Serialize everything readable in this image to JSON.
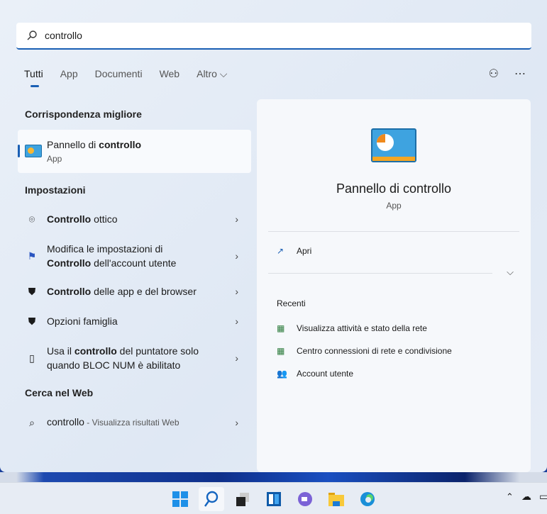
{
  "search": {
    "value": "controllo"
  },
  "tabs": [
    {
      "label": "Tutti"
    },
    {
      "label": "App"
    },
    {
      "label": "Documenti"
    },
    {
      "label": "Web"
    },
    {
      "label": "Altro ⌵"
    }
  ],
  "best_match": {
    "heading": "Corrispondenza migliore",
    "title_normal": "Pannello di ",
    "title_bold": "controllo",
    "subtitle": "App"
  },
  "settings": {
    "heading": "Impostazioni",
    "items": [
      {
        "bold": "Controllo",
        "rest": " ottico",
        "icon": "eye-scan-icon"
      },
      {
        "pre": "Modifica le impostazioni di",
        "bold": "Controllo",
        "rest": " dell'account utente",
        "icon": "flag-icon"
      },
      {
        "bold": "Controllo",
        "rest": " delle app e del browser",
        "icon": "shield-icon"
      },
      {
        "bold": "",
        "rest": "Opzioni famiglia",
        "icon": "shield-icon"
      },
      {
        "pre1": "Usa il ",
        "bold": "controllo",
        "rest": " del puntatore solo",
        "line2": "quando BLOC NUM è abilitato",
        "icon": "mouse-icon"
      }
    ]
  },
  "web": {
    "heading": "Cerca nel Web",
    "query": "controllo",
    "suffix": " - Visualizza risultati Web"
  },
  "preview": {
    "title": "Pannello di controllo",
    "subtitle": "App",
    "open_label": "Apri",
    "recent_heading": "Recenti",
    "recent": [
      "Visualizza attività e stato della rete",
      "Centro connessioni di rete e condivisione",
      "Account utente"
    ]
  },
  "colors": {
    "accent": "#1a5fb4"
  }
}
